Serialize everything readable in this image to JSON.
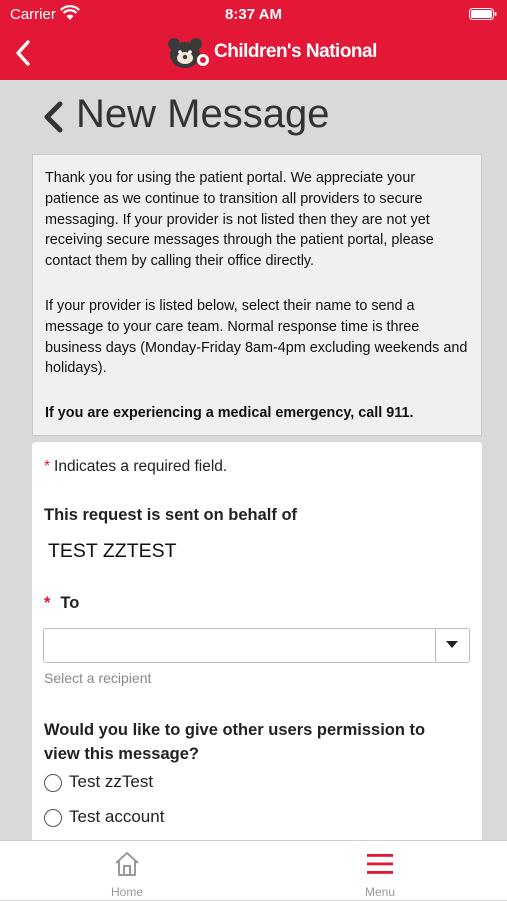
{
  "status_bar": {
    "carrier": "Carrier",
    "time": "8:37 AM"
  },
  "header": {
    "brand_name": "Children's National",
    "brand_color": "#e31837",
    "icons": [
      "back-chevron-icon",
      "bear-logo-icon"
    ]
  },
  "page": {
    "title": "New Message"
  },
  "notice": {
    "paragraph1": "Thank you for using the patient portal.  We appreciate your patience as we continue to transition all providers to secure messaging. If your provider is not listed then they are not yet receiving secure messages through the patient portal, please contact them by calling their office directly.",
    "paragraph2": "If your provider is listed below, select their name to send a message to your care team. Normal response time is three business days (Monday-Friday 8am-4pm excluding weekends and holidays).",
    "emergency": "If you are experiencing a medical emergency, call 911."
  },
  "form": {
    "required_marker": "*",
    "required_note": "Indicates a required field.",
    "behalf_label": "This request is sent on behalf of",
    "behalf_value": "TEST ZZTEST",
    "to_label": "To",
    "to_value": "",
    "to_helper": "Select a recipient",
    "permission_question": "Would you like to give other users permission to view this message?",
    "permission_options": [
      {
        "label": "Test zzTest",
        "checked": false
      },
      {
        "label": "Test account",
        "checked": false
      }
    ]
  },
  "tabbar": {
    "home_label": "Home",
    "menu_label": "Menu",
    "active_color": "#e31837",
    "inactive_color": "#999999"
  }
}
